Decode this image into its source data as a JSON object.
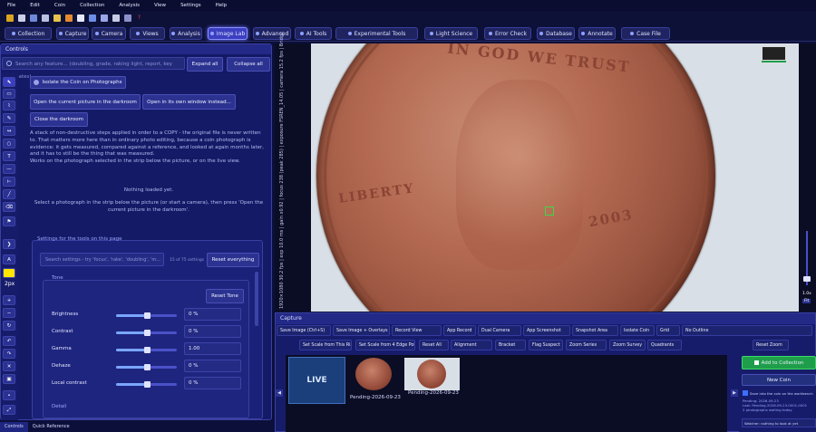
{
  "menu": [
    "File",
    "Edit",
    "Coin",
    "Collection",
    "Analysis",
    "View",
    "Settings",
    "Help"
  ],
  "tabs": [
    {
      "label": "Collection",
      "icon": "collection-icon"
    },
    {
      "label": "Capture",
      "icon": "capture-icon"
    },
    {
      "label": "Camera",
      "icon": "camera-icon"
    },
    {
      "label": "Views",
      "icon": "views-icon"
    },
    {
      "label": "Analysis",
      "icon": "analysis-icon"
    },
    {
      "label": "Image Lab",
      "icon": "image-lab-icon",
      "active": true
    },
    {
      "label": "Advanced",
      "icon": "advanced-icon"
    },
    {
      "label": "AI Tools",
      "icon": "ai-icon"
    },
    {
      "label": "Experimental Tools",
      "icon": "experimental-icon"
    },
    {
      "label": "Light Science",
      "icon": "light-icon"
    },
    {
      "label": "Error Check",
      "icon": "error-check-icon"
    },
    {
      "label": "Database",
      "icon": "database-icon"
    },
    {
      "label": "Annotate",
      "icon": "annotate-icon"
    },
    {
      "label": "Case File",
      "icon": "case-file-icon"
    }
  ],
  "controls": {
    "title": "Controls",
    "search_placeholder": "Search any feature... (doubling, grade, raking light, report, key dates)",
    "expand_all": "Expand all",
    "collapse_all": "Collapse all",
    "isolate_button": "Isolate the Coin on Photographs",
    "open_darkroom": "Open the current picture in the darkroom",
    "open_window": "Open in its own window instead...",
    "close_darkroom": "Close the darkroom",
    "description_1": "A stack of non-destructive steps applied in order to a COPY - the original file is never written to. That matters more here than in ordinary photo editing, because a coin photograph is evidence: it gets measured, compared against a reference, and looked at again months later, and it has to still be the thing that was measured.",
    "description_2": "Works on the photograph selected in the strip below the picture, or on the live view.",
    "nothing_loaded": "Nothing loaded yet.",
    "select_hint": "Select a photograph in the strip below the picture (or start a camera), then press 'Open the current picture in the darkroom'.",
    "size_label": "2px",
    "settings_title": "Settings for the tools on this page",
    "settings_search_placeholder": "Search settings - try 'focus', 'rake', 'doubling', 'm...",
    "settings_count": "15 of 75 settings",
    "reset_everything": "Reset everything",
    "tone_title": "Tone",
    "reset_tone": "Reset Tone",
    "params": [
      {
        "label": "Brightness",
        "value": "0 %",
        "level": 0.5
      },
      {
        "label": "Contrast",
        "value": "0 %",
        "level": 0.5
      },
      {
        "label": "Gamma",
        "value": "1.00",
        "level": 0.5
      },
      {
        "label": "Dehaze",
        "value": "0 %",
        "level": 0.5
      },
      {
        "label": "Local contrast",
        "value": "0 %",
        "level": 0.5
      }
    ],
    "detail_title": "Detail",
    "bottom_tabs": [
      "Controls",
      "Quick Reference"
    ]
  },
  "camera": {
    "side_readout": "1920×1080 30.2 fps | exp 10.0 ms | gain x0.92 | focus 238 (peak 285) | exposure FSREN_14.05 | camera 15.2 fps | Bridge",
    "coin_text_top": "IN GOD WE TRUST",
    "coin_text_liberty": "LIBERTY",
    "coin_year": "2003",
    "zoom_label": "1.0x",
    "fit_label": "Fit"
  },
  "capture": {
    "title": "Capture",
    "row1": [
      "Save Image (Ctrl+S)",
      "Save Image + Overlays",
      "Record View",
      "App Record",
      "Dual Camera",
      "App Screenshot",
      "Snapshot Area",
      "Isolate Coin",
      "Grid",
      "No Outline"
    ],
    "row2": [
      "Set Scale from This Ring",
      "Set Scale from 4 Edge Points",
      "Reset All",
      "Alignment",
      "Bracket",
      "Flag Suspect",
      "Zoom Series",
      "Zoom Survey",
      "Quadrants",
      "Reset Zoom"
    ],
    "live_label": "LIVE",
    "thumb_captions": [
      "Pending-2026-09-23",
      "Pending-2026-09-23"
    ],
    "add_to_collection": "Add to Collection",
    "new_coin": "New Coin",
    "save_into": "Save into the coin on the workbench",
    "pending_lines": [
      "Pending: 2026-09-23",
      "Last: Pending-2026-09-23-0001-0001",
      "2 photographs waiting today"
    ],
    "watcher": "Watcher: nothing to look at yet"
  },
  "colors": {
    "accent": "#3b3fbf",
    "panel": "#141a66",
    "green": "#1e9e4a"
  }
}
